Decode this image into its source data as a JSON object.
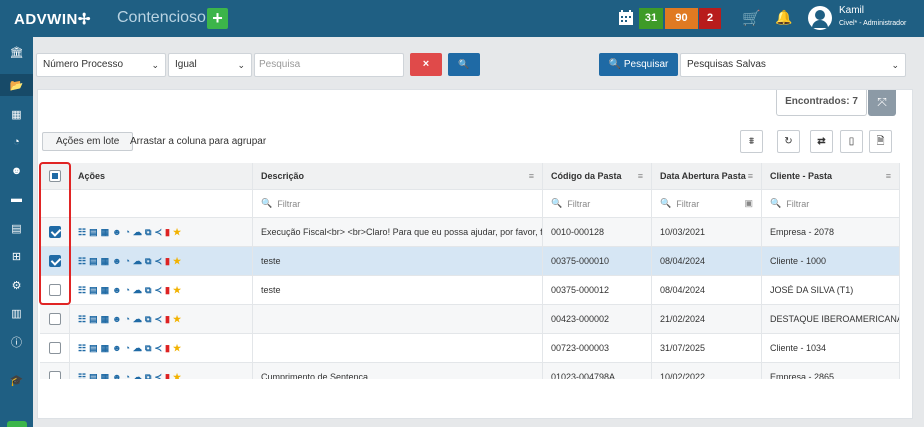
{
  "topbar": {
    "logo": "ADVWIN✢",
    "module": "Contencioso",
    "add": "+",
    "badges": [
      "31",
      "90",
      "2"
    ],
    "user": "Kamil",
    "role": "Civel* - Administrador"
  },
  "filters": {
    "field": "Número Processo",
    "op": "Igual",
    "search_placeholder": "Pesquisa",
    "clear": "×",
    "go": "🔍",
    "search_btn": "🔍 Pesquisar",
    "saved": "Pesquisas Salvas"
  },
  "panel": {
    "found": "Encontrados: 7",
    "lote": "Ações em lote",
    "drag": "Arrastar a coluna para agrupar"
  },
  "columns": [
    "Ações",
    "Descrição",
    "Código da Pasta",
    "Data Abertura Pasta",
    "Cliente - Pasta"
  ],
  "filter_placeholder": "Filtrar",
  "rows": [
    {
      "checked": true,
      "desc": "Execução Fiscal<br> <br>Claro! Para que eu possa ajudar, por favor, f...",
      "code": "0010-000128",
      "date": "10/03/2021",
      "client": "Empresa - 2078"
    },
    {
      "checked": true,
      "desc": "teste",
      "code": "00375-000010",
      "date": "08/04/2024",
      "client": "Cliente - 1000"
    },
    {
      "checked": false,
      "desc": "teste",
      "code": "00375-000012",
      "date": "08/04/2024",
      "client": "JOSÉ DA SILVA (T1)"
    },
    {
      "checked": false,
      "desc": "",
      "code": "00423-000002",
      "date": "21/02/2024",
      "client": "DESTAQUE IBEROAMERICANAS ..."
    },
    {
      "checked": false,
      "desc": "",
      "code": "00723-000003",
      "date": "31/07/2025",
      "client": "Cliente - 1034"
    },
    {
      "checked": false,
      "desc": "Cumprimento de Sentenca",
      "code": "01023-004798A",
      "date": "10/02/2022",
      "client": "Empresa - 2865"
    }
  ]
}
